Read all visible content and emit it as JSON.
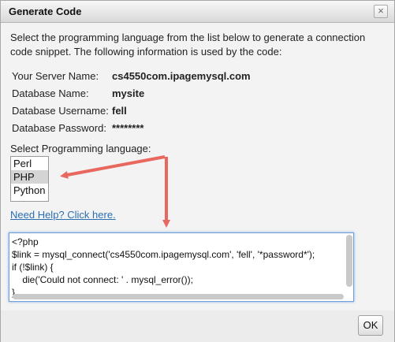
{
  "dialog": {
    "title": "Generate Code",
    "close_icon": "close-icon",
    "close_glyph": "×"
  },
  "intro": {
    "text": "Select the programming language from the list below to generate a connection code snippet. The following information is used by the code:"
  },
  "info": {
    "rows": [
      {
        "label": "Your Server Name:",
        "value": "cs4550com.ipagemysql.com"
      },
      {
        "label": "Database Name:",
        "value": "mysite"
      },
      {
        "label": "Database Username:",
        "value": "fell"
      },
      {
        "label": "Database Password:",
        "value": "********"
      }
    ]
  },
  "language": {
    "heading": "Select Programming language:",
    "options": [
      "Perl",
      "PHP",
      "Python"
    ],
    "selected": "PHP"
  },
  "help_link": "Need Help? Click here.",
  "code": {
    "text": "<?php\n$link = mysql_connect('cs4550com.ipagemysql.com', 'fell', '*password*');\nif (!$link) {\n    die('Could not connect: ' . mysql_error());\n}"
  },
  "footer": {
    "ok_label": "OK"
  },
  "colors": {
    "annotation_arrow": "#e8685f",
    "link": "#2a6fb2",
    "selection": "#d4d4d4",
    "focus_border": "#6fa0d9"
  }
}
